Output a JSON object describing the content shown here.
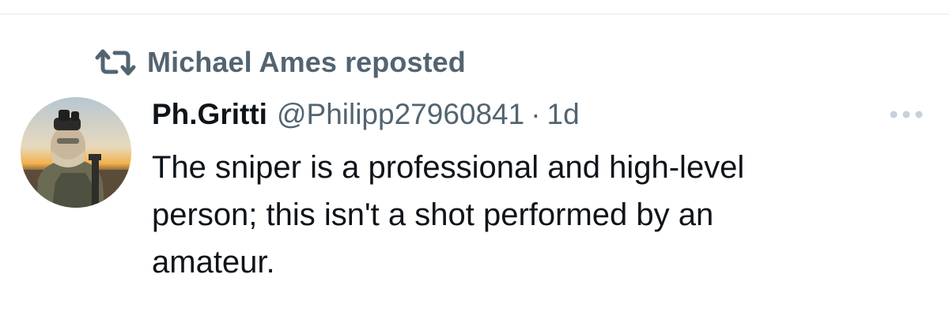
{
  "repost": {
    "icon": "repost-icon",
    "text": "Michael Ames reposted"
  },
  "tweet": {
    "avatar_icon": "avatar",
    "display_name": "Ph.Gritti",
    "handle": "@Philipp27960841",
    "separator": "·",
    "time": "1d",
    "more_icon": "more-icon",
    "text_lines": [
      "The sniper is a professional and high-level",
      "person; this isn't a shot performed by an",
      "amateur."
    ]
  },
  "colors": {
    "text_primary": "#0f1419",
    "text_secondary": "#536471",
    "divider": "#eff3f4",
    "more_icon": "#c8d1d8"
  }
}
